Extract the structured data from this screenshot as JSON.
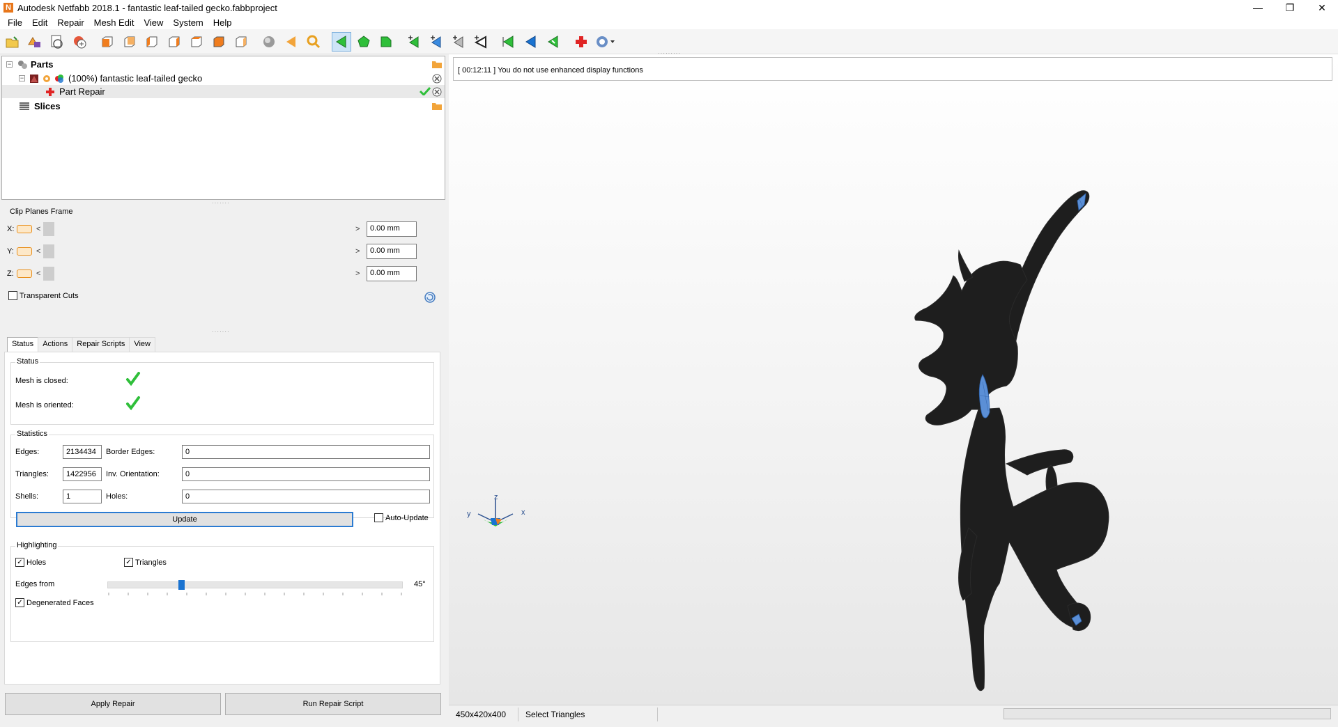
{
  "window": {
    "title": "Autodesk Netfabb 2018.1 - fantastic leaf-tailed gecko.fabbproject",
    "app_icon_letter": "N",
    "controls": {
      "minimize": "—",
      "restore": "❐",
      "close": "✕"
    }
  },
  "menu": [
    "File",
    "Edit",
    "Repair",
    "Mesh Edit",
    "View",
    "System",
    "Help"
  ],
  "toolbar": {
    "icons": [
      "open-project-icon",
      "add-part-icon",
      "load-part-icon",
      "new-part-icon",
      "view-front-icon",
      "view-back-icon",
      "view-left-icon",
      "view-right-icon",
      "view-top-icon",
      "view-bottom-icon",
      "view-iso-icon",
      "sphere-icon",
      "prev-arrow-icon",
      "zoom-icon",
      "select-triangle-icon",
      "select-surface-icon",
      "select-shell-icon",
      "add-triangle-icon",
      "select-edge-icon",
      "cut-icon",
      "lasso-icon",
      "triangle-green-icon",
      "triangle-blue-icon",
      "triangle-select-icon",
      "repair-cross-icon",
      "help-icon"
    ],
    "active_icon": "select-triangle-icon"
  },
  "tree": {
    "parts_label": "Parts",
    "part_label": "(100%) fantastic leaf-tailed gecko",
    "repair_label": "Part Repair",
    "slices_label": "Slices",
    "expander_minus": "−"
  },
  "clip_planes": {
    "title": "Clip Planes Frame",
    "rows": [
      {
        "axis": "X:",
        "value": "0.00 mm"
      },
      {
        "axis": "Y:",
        "value": "0.00 mm"
      },
      {
        "axis": "Z:",
        "value": "0.00 mm"
      }
    ],
    "arrow_left": "<",
    "arrow_right": ">",
    "transparent_cuts": "Transparent Cuts"
  },
  "tabs": [
    "Status",
    "Actions",
    "Repair Scripts",
    "View"
  ],
  "active_tab": "Status",
  "status": {
    "title": "Status",
    "mesh_closed": "Mesh is closed:",
    "mesh_oriented": "Mesh is oriented:"
  },
  "statistics": {
    "title": "Statistics",
    "edges_label": "Edges:",
    "edges": "2134434",
    "border_edges_label": "Border Edges:",
    "border_edges": "0",
    "triangles_label": "Triangles:",
    "triangles": "1422956",
    "inv_orientation_label": "Inv. Orientation:",
    "inv_orientation": "0",
    "shells_label": "Shells:",
    "shells": "1",
    "holes_label": "Holes:",
    "holes": "0",
    "update": "Update",
    "auto_update": "Auto-Update"
  },
  "highlighting": {
    "title": "Highlighting",
    "holes": "Holes",
    "holes_checked": true,
    "triangles": "Triangles",
    "triangles_checked": true,
    "edges_from": "Edges from",
    "edges_angle": "45°",
    "edges_fraction": 0.25,
    "degenerated": "Degenerated Faces",
    "degenerated_checked": true,
    "check_glyph": "✓"
  },
  "buttons": {
    "apply_repair": "Apply Repair",
    "run_repair_script": "Run Repair Script"
  },
  "viewport": {
    "message": "[ 00:12:11 ] You do not use enhanced display functions",
    "axis_x": "x",
    "axis_y": "y",
    "axis_z": "z",
    "model_color": "#1e1e1e",
    "highlight_color": "#5b8fd6"
  },
  "statusbar": {
    "dimensions": "450x420x400",
    "mode": "Select Triangles"
  }
}
